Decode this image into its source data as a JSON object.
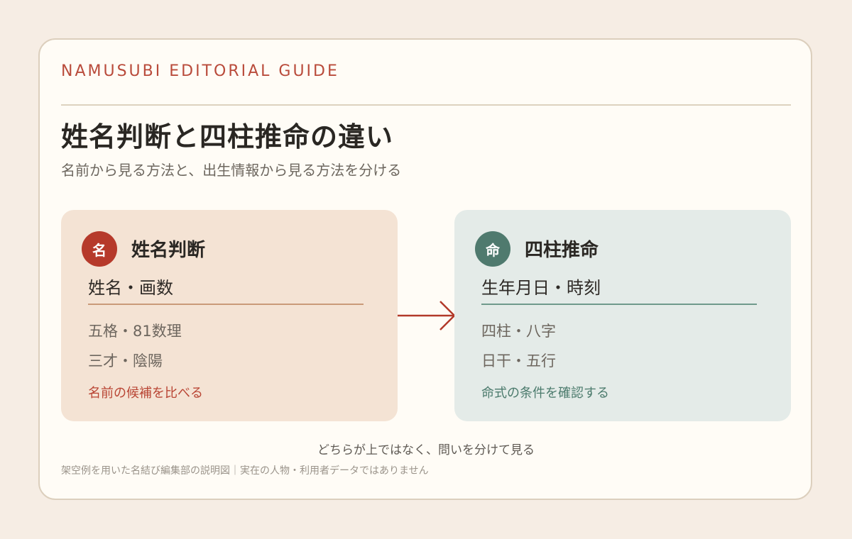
{
  "header": {
    "eyebrow": "NAMUSUBI EDITORIAL GUIDE",
    "title": "姓名判断と四柱推命の違い",
    "subtitle": "名前から見る方法と、出生情報から見る方法を分ける"
  },
  "panels": {
    "left": {
      "badge": "名",
      "title": "姓名判断",
      "main": "姓名・画数",
      "items": [
        "五格・81数理",
        "三才・陰陽"
      ],
      "note": "名前の候補を比べる"
    },
    "right": {
      "badge": "命",
      "title": "四柱推命",
      "main": "生年月日・時刻",
      "items": [
        "四柱・八字",
        "日干・五行"
      ],
      "note": "命式の条件を確認する"
    }
  },
  "arrow_icon": "arrow-right-icon",
  "caption": "どちらが上ではなく、問いを分けて見る",
  "footnote": "架空例を用いた名結び編集部の説明図｜実在の人物・利用者データではありません",
  "colors": {
    "accent_red": "#b63a2b",
    "accent_green": "#4f7a6e",
    "left_panel_bg": "#f4e3d4",
    "right_panel_bg": "#e4ebe8",
    "page_bg": "#f6ede4"
  }
}
